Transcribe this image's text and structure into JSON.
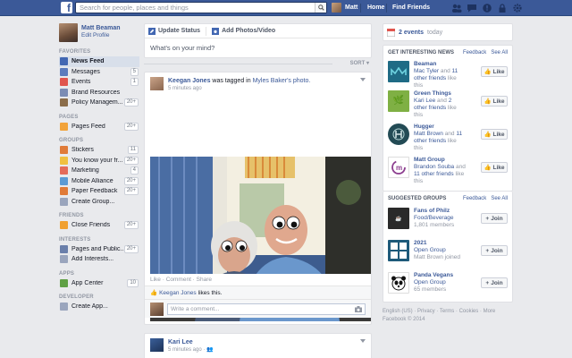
{
  "topbar": {
    "logo": "f",
    "search_placeholder": "Search for people, places and things",
    "user_name": "Matt",
    "home_label": "Home",
    "find_friends_label": "Find Friends"
  },
  "profile": {
    "name": "Matt Beaman",
    "edit_label": "Edit Profile"
  },
  "nav": {
    "favorites_head": "FAVORITES",
    "favorites": [
      {
        "label": "News Feed",
        "count": "",
        "color": "#4267b2"
      },
      {
        "label": "Messages",
        "count": "5",
        "color": "#5b7bbd"
      },
      {
        "label": "Events",
        "count": "1",
        "color": "#e0554e"
      },
      {
        "label": "Brand Resources",
        "count": "",
        "color": "#7b8cb4"
      },
      {
        "label": "Policy Managem...",
        "count": "20+",
        "color": "#8b6d4a"
      }
    ],
    "pages_head": "PAGES",
    "pages": [
      {
        "label": "Pages Feed",
        "count": "20+",
        "color": "#f2a33a"
      }
    ],
    "groups_head": "GROUPS",
    "groups": [
      {
        "label": "Stickers",
        "count": "11",
        "color": "#e07b39"
      },
      {
        "label": "You know your fr...",
        "count": "20+",
        "color": "#f0c040"
      },
      {
        "label": "Marketing",
        "count": "4",
        "color": "#e46b5a"
      },
      {
        "label": "Mobile Alliance",
        "count": "20+",
        "color": "#5b9bd5"
      },
      {
        "label": "Paper Feedback",
        "count": "20+",
        "color": "#e07b39"
      },
      {
        "label": "Create Group...",
        "count": "",
        "color": "#9aa5bd"
      }
    ],
    "friends_head": "FRIENDS",
    "friends": [
      {
        "label": "Close Friends",
        "count": "20+",
        "color": "#f0a030"
      }
    ],
    "interests_head": "INTERESTS",
    "interests": [
      {
        "label": "Pages and Public...",
        "count": "20+",
        "color": "#6a7fab"
      },
      {
        "label": "Add Interests...",
        "count": "",
        "color": "#9aa5bd"
      }
    ],
    "apps_head": "APPS",
    "apps": [
      {
        "label": "App Center",
        "count": "10",
        "color": "#5fa045"
      }
    ],
    "developer_head": "DEVELOPER",
    "developer": [
      {
        "label": "Create App...",
        "count": "",
        "color": "#9aa5bd"
      }
    ]
  },
  "composer": {
    "update_status": "Update Status",
    "add_photos": "Add Photos/Video",
    "prompt": "What's on your mind?",
    "sort_label": "SORT"
  },
  "story1": {
    "author": "Keegan Jones",
    "verb": " was tagged in ",
    "target": "Myles Baker's photo.",
    "time": "5 minutes ago",
    "actions": "Like · Comment · Share",
    "like_name": "Keegan Jones",
    "like_suffix": " likes this.",
    "comment_placeholder": "Write a comment..."
  },
  "story2": {
    "author": "Kari Lee",
    "time": "5 minutes ago"
  },
  "right": {
    "events_count": "2 events",
    "events_suffix": "today",
    "interesting_head": "GET INTERESTING NEWS",
    "feedback": "Feedback",
    "see_all": "See All",
    "like_label": "Like",
    "join_label": "Join",
    "pages": [
      {
        "name": "Beaman",
        "l1": "Mac Tyler",
        "l2": " and ",
        "l3": "11 other friends",
        "l4": " like this"
      },
      {
        "name": "Green Things",
        "l1": "Kari Lee",
        "l2": " and ",
        "l3": "2 other friends",
        "l4": " like this"
      },
      {
        "name": "Hugger",
        "l1": "Matt Brown",
        "l2": " and ",
        "l3": "11 other friends",
        "l4": " like this"
      },
      {
        "name": "Matt Group",
        "l1": "Brandon Souba",
        "l2": " and ",
        "l3": "11 other friends",
        "l4": " like this"
      }
    ],
    "groups_head": "SUGGESTED GROUPS",
    "groups": [
      {
        "name": "Fans of Philz",
        "sub": "Food/Beverage",
        "meta": "1,801 members"
      },
      {
        "name": "2021",
        "sub": "Open Group",
        "meta": "Matt Brown joined"
      },
      {
        "name": "Panda Vegans",
        "sub": "Open Group",
        "meta": "65 members"
      }
    ],
    "footer1": "English (US) · Privacy · Terms · Cookies · More",
    "footer2": "Facebook © 2014"
  }
}
